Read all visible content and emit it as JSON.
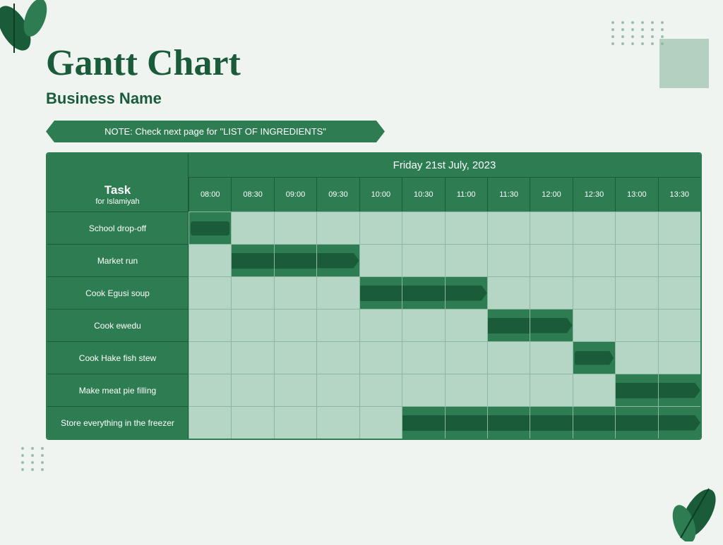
{
  "title": "Gantt Chart",
  "business_name": "Business Name",
  "note": "NOTE: Check next page for \"LIST OF INGREDIENTS\"",
  "date_header": "Friday 21st July, 2023",
  "task_header": {
    "main": "Task",
    "sub": "for Islamiyah"
  },
  "time_slots": [
    "08:00",
    "08:30",
    "09:00",
    "09:30",
    "10:00",
    "10:30",
    "11:00",
    "11:30",
    "12:00",
    "12:30",
    "13:00",
    "13:30"
  ],
  "tasks": [
    {
      "label": "School drop-off",
      "bar_start": 0,
      "bar_end": 0,
      "bar_type": "short"
    },
    {
      "label": "Market run",
      "bar_start": 1,
      "bar_end": 3,
      "bar_type": "medium"
    },
    {
      "label": "Cook Egusi soup",
      "bar_start": 4,
      "bar_end": 6,
      "bar_type": "medium"
    },
    {
      "label": "Cook ewedu",
      "bar_start": 7,
      "bar_end": 8,
      "bar_type": "medium"
    },
    {
      "label": "Cook Hake fish stew",
      "bar_start": 9,
      "bar_end": 9,
      "bar_type": "short-arrow"
    },
    {
      "label": "Make meat pie filling",
      "bar_start": 10,
      "bar_end": 11,
      "bar_type": "medium"
    },
    {
      "label": "Store everything in the freezer",
      "bar_start": 5,
      "bar_end": 11,
      "bar_type": "long"
    }
  ],
  "colors": {
    "dark_green": "#1a5c3a",
    "medium_green": "#2e7d52",
    "light_green": "#b5d5c5",
    "bg": "#f0f4f0"
  }
}
